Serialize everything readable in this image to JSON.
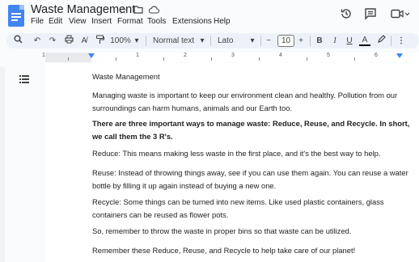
{
  "app": {
    "title": "Waste Management",
    "menus": [
      "File",
      "Edit",
      "View",
      "Insert",
      "Format",
      "Tools",
      "Extensions",
      "Help"
    ],
    "title_icons": [
      "star-icon",
      "folder-move-icon",
      "cloud-status-icon"
    ],
    "right_icons": [
      "history-icon",
      "comments-icon",
      "video-call-icon"
    ]
  },
  "toolbar": {
    "zoom": "100%",
    "style": "Normal text",
    "font": "Lato",
    "font_size": "10",
    "minus": "−",
    "plus": "+",
    "bold": "B",
    "italic": "I",
    "underline": "U",
    "text_color": "A"
  },
  "ruler": {
    "numbers": [
      "1",
      "1",
      "2",
      "3",
      "4",
      "5",
      "6"
    ]
  },
  "document": {
    "paragraphs": [
      {
        "text": "Waste Management",
        "bold": false
      },
      {
        "text": "Managing waste is important to keep our environment clean and healthy. Pollution from our surroundings can harm humans, animals and our Earth too.",
        "bold": false
      },
      {
        "text": "There are three important ways to manage waste: Reduce, Reuse, and Recycle. In short, we call them the 3 R's.",
        "bold": true
      },
      {
        "text": "Reduce: This means making less waste in the first place, and it's the best way to help.",
        "bold": false
      },
      {
        "text": "Reuse: Instead of throwing things away, see if you can use them again. You can reuse a water bottle by filling it up again instead of buying a new one.",
        "bold": false
      },
      {
        "text": "Recycle: Some things can be turned into new items. Like used plastic containers, glass containers can be reused as flower pots.",
        "bold": false
      },
      {
        "text": " So, remember to throw the waste in proper bins so that waste can be utilized.",
        "bold": false
      },
      {
        "text": "Remember these Reduce, Reuse, and Recycle to help take care of our planet!",
        "bold": false
      }
    ]
  },
  "colors": {
    "accent": "#4285f4",
    "toolbar_bg": "#edf2fa",
    "background": "#f9fbfd"
  }
}
